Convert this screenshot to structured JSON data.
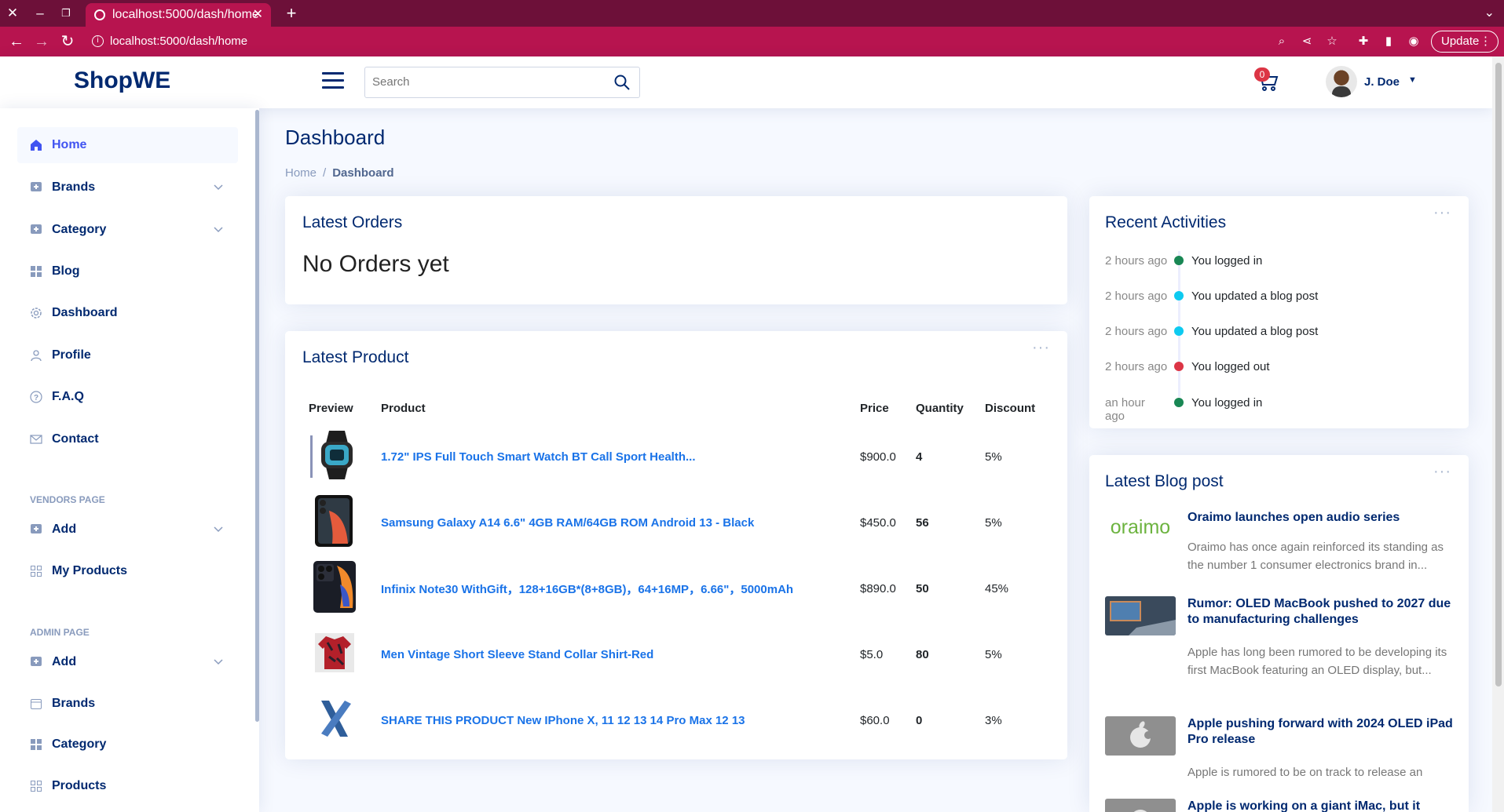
{
  "browser": {
    "tab_title": "localhost:5000/dash/home",
    "url": "localhost:5000/dash/home",
    "update_label": "Update"
  },
  "header": {
    "logo": "ShopWE",
    "search_placeholder": "Search",
    "cart_count": "0",
    "user_name": "J. Doe"
  },
  "sidebar": {
    "items": [
      {
        "label": "Home",
        "icon": "home-icon"
      },
      {
        "label": "Brands",
        "icon": "plus-square-icon"
      },
      {
        "label": "Category",
        "icon": "plus-square-icon"
      },
      {
        "label": "Blog",
        "icon": "grid-icon"
      },
      {
        "label": "Dashboard",
        "icon": "gear-icon"
      },
      {
        "label": "Profile",
        "icon": "person-icon"
      },
      {
        "label": "F.A.Q",
        "icon": "question-icon"
      },
      {
        "label": "Contact",
        "icon": "envelope-icon"
      }
    ],
    "vendors_heading": "VENDORS PAGE",
    "vendors_items": [
      {
        "label": "Add",
        "icon": "plus-square-icon"
      },
      {
        "label": "My Products",
        "icon": "grid-outline-icon"
      }
    ],
    "admin_heading": "ADMIN PAGE",
    "admin_items": [
      {
        "label": "Add",
        "icon": "plus-square-icon"
      },
      {
        "label": "Brands",
        "icon": "calendar-icon"
      },
      {
        "label": "Category",
        "icon": "grid-icon"
      },
      {
        "label": "Products",
        "icon": "grid-outline-icon"
      }
    ]
  },
  "main": {
    "title": "Dashboard",
    "breadcrumb": [
      "Home",
      "/",
      "Dashboard"
    ],
    "orders": {
      "title": "Latest Orders",
      "empty": "No Orders yet"
    },
    "products": {
      "title": "Latest Product",
      "columns": [
        "Preview",
        "Product",
        "Price",
        "Quantity",
        "Discount"
      ],
      "rows": [
        {
          "name": "1.72\" IPS Full Touch Smart Watch BT Call Sport Health...",
          "price": "$900.0",
          "qty": "4",
          "discount": "5%"
        },
        {
          "name": "Samsung Galaxy A14 6.6\" 4GB RAM/64GB ROM Android 13 - Black",
          "price": "$450.0",
          "qty": "56",
          "discount": "5%"
        },
        {
          "name": "Infinix Note30 WithGift，128+16GB*(8+8GB)，64+16MP，6.66\"，5000mAh",
          "price": "$890.0",
          "qty": "50",
          "discount": "45%"
        },
        {
          "name": "Men Vintage Short Sleeve Stand Collar Shirt-Red",
          "price": "$5.0",
          "qty": "80",
          "discount": "5%"
        },
        {
          "name": "SHARE THIS PRODUCT New IPhone X, 11 12 13 14 Pro Max 12 13",
          "price": "$60.0",
          "qty": "0",
          "discount": "3%"
        }
      ]
    },
    "activities": {
      "title": "Recent Activities",
      "items": [
        {
          "time": "2 hours ago",
          "text": "You logged in",
          "color": "#198754"
        },
        {
          "time": "2 hours ago",
          "text": "You updated a blog post",
          "color": "#0dcaf0"
        },
        {
          "time": "2 hours ago",
          "text": "You updated a blog post",
          "color": "#0dcaf0"
        },
        {
          "time": "2 hours ago",
          "text": "You logged out",
          "color": "#dc3545"
        },
        {
          "time": "an hour ago",
          "text": "You logged in",
          "color": "#198754"
        }
      ]
    },
    "blog": {
      "title": "Latest Blog post",
      "posts": [
        {
          "title": "Oraimo launches open audio series",
          "desc": "Oraimo has once again reinforced its standing as the number 1 consumer electronics brand in...",
          "thumb_text": "oraimo"
        },
        {
          "title": "Rumor: OLED MacBook pushed to 2027 due to manufacturing challenges",
          "desc": "Apple has long been rumored to be developing its first MacBook featuring an OLED display, but..."
        },
        {
          "title": "Apple pushing forward with 2024 OLED iPad Pro release",
          "desc": "Apple is rumored to be on track to release an"
        },
        {
          "title": "Apple is working on a giant iMac, but it"
        }
      ]
    }
  },
  "colors": {
    "chrome_dark": "#6d1039",
    "chrome": "#b7144f",
    "brand": "#012970",
    "accent": "#4154f1",
    "link": "#1a73e8"
  }
}
